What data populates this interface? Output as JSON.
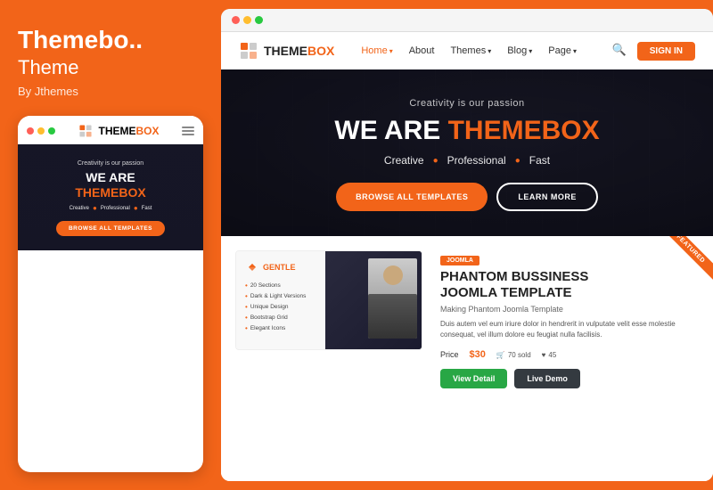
{
  "left": {
    "title": "Themebo..",
    "subtitle": "Theme",
    "by_line": "By Jthemes",
    "dots": [
      "red",
      "yellow",
      "green"
    ],
    "mobile": {
      "logo_prefix": "THEME",
      "logo_suffix": "BOX",
      "tagline": "Creativity is our passion",
      "headline_line1": "WE ARE",
      "headline_line2": "THEMEBOX",
      "features": [
        "Creative",
        "Professional",
        "Fast"
      ],
      "cta": "BROWSE ALL TEMPLATES"
    }
  },
  "right": {
    "browser_dots": [
      "red",
      "yellow",
      "green"
    ],
    "nav": {
      "logo_prefix": "THEME",
      "logo_suffix": "BOX",
      "links": [
        {
          "label": "Home",
          "has_dropdown": true,
          "active": true
        },
        {
          "label": "About",
          "has_dropdown": false,
          "active": false
        },
        {
          "label": "Themes",
          "has_dropdown": true,
          "active": false
        },
        {
          "label": "Blog",
          "has_dropdown": true,
          "active": false
        },
        {
          "label": "Page",
          "has_dropdown": true,
          "active": false
        }
      ],
      "signin": "SIGN IN"
    },
    "hero": {
      "tagline": "Creativity is our passion",
      "headline_line1": "WE ARE",
      "headline_line2": "THEMEBOX",
      "features": [
        "Creative",
        "Professional",
        "Fast"
      ],
      "btn_browse": "BROWSE ALL TEMPLATES",
      "btn_learn": "LEARN MORE"
    },
    "product": {
      "badge": "JOOMLA",
      "title": "PHANTOM BUSSINESS\nJOOMLA TEMPLATE",
      "subtitle": "Making Phantom Joomla Template",
      "description": "Duis autem vel eum iriure dolor in hendrerit in vulputate velit esse molestie consequat, vel illum dolore eu feugiat nulla facilisis.",
      "price_label": "Price",
      "price": "$30",
      "sold_count": "70 sold",
      "liked_count": "45",
      "btn_detail": "View Detail",
      "btn_demo": "Live Demo",
      "featured_label": "FEATURED",
      "card_logo": "GENTLE",
      "features_list": [
        "20 Sections",
        "Dark & Light Versions",
        "Unique Design",
        "Bootstrap Grid",
        "Elegant Icons"
      ]
    }
  }
}
